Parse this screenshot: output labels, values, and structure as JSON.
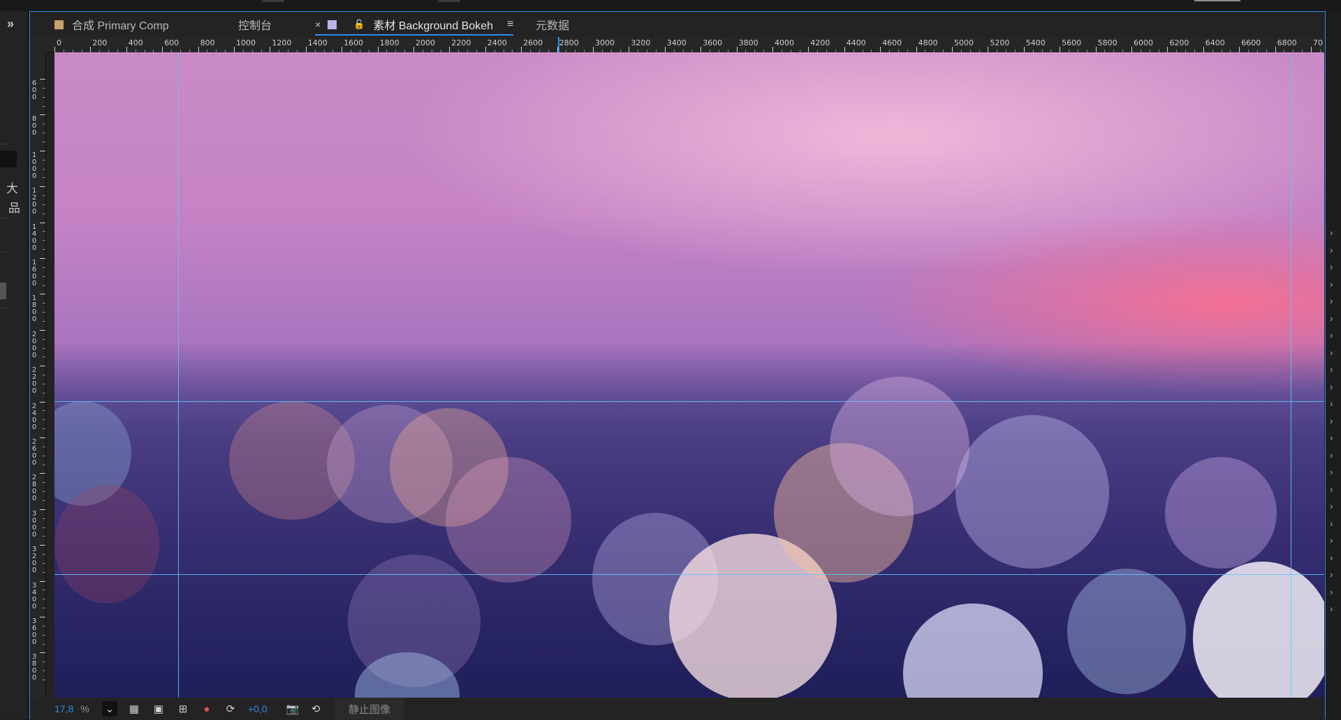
{
  "tabs": [
    {
      "label": "合成 Primary Comp",
      "swatch": "#c8a26b"
    },
    {
      "label": "控制台"
    },
    {
      "label": "素材 Background Bokeh",
      "swatch": "#b8b4e6",
      "close": "×",
      "lock": "🔓",
      "menu": "≡"
    },
    {
      "label": "元数据"
    }
  ],
  "left_dock": {
    "expand": "»",
    "label": "大",
    "tree_icon": "品"
  },
  "ruler": {
    "horizontal_labels": [
      "0",
      "200",
      "400",
      "600",
      "800",
      "1000",
      "1200",
      "1400",
      "1600",
      "1800",
      "2000",
      "2200",
      "2400",
      "2600",
      "2800",
      "3000",
      "3200",
      "3400",
      "3600",
      "3800",
      "4000",
      "4200",
      "4400",
      "4600",
      "4800",
      "5000",
      "5200",
      "5400",
      "5600",
      "5800",
      "6000",
      "6200",
      "6400",
      "6600",
      "6800",
      "70"
    ],
    "vertical_labels": [
      "600",
      "800",
      "1000",
      "1200",
      "1400",
      "1600",
      "1800",
      "2000",
      "2200",
      "2400",
      "2600",
      "2800",
      "3000",
      "3200",
      "3400",
      "3600",
      "3800"
    ]
  },
  "bottom_toolbar": {
    "zoom": "17,8",
    "zoom_unit": "%",
    "exposure": "+0,0",
    "still_image": "静止图像"
  },
  "colors": {
    "accent": "#2d8ceb",
    "guide": "#5cc8ff",
    "panel_bg": "#232323"
  }
}
